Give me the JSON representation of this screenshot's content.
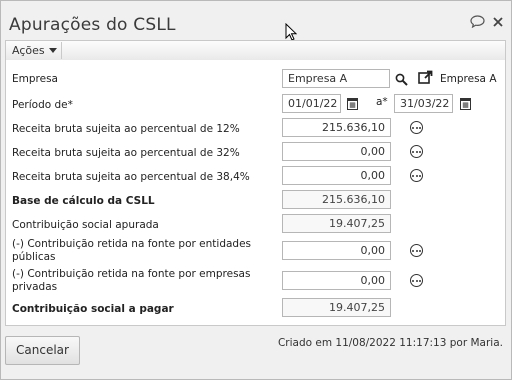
{
  "dialog": {
    "title": "Apurações do CSLL",
    "toolbar": {
      "actions_label": "Ações"
    }
  },
  "form": {
    "empresa": {
      "label": "Empresa",
      "value": "Empresa A",
      "linked_name": "Empresa A"
    },
    "periodo": {
      "label": "Período de*",
      "from": "01/01/22",
      "to_label": "a*",
      "to": "31/03/22"
    },
    "rows": [
      {
        "label": "Receita bruta sujeita ao percentual de 12%",
        "value": "215.636,10",
        "bold": false,
        "editable": true
      },
      {
        "label": "Receita bruta sujeita ao percentual de 32%",
        "value": "0,00",
        "bold": false,
        "editable": true
      },
      {
        "label": "Receita bruta sujeita ao percentual de 38,4%",
        "value": "0,00",
        "bold": false,
        "editable": true
      },
      {
        "label": "Base de cálculo da CSLL",
        "value": "215.636,10",
        "bold": true,
        "editable": false
      },
      {
        "label": "Contribuição social apurada",
        "value": "19.407,25",
        "bold": false,
        "editable": false
      },
      {
        "label": "(-) Contribuição retida na fonte por entidades públicas",
        "value": "0,00",
        "bold": false,
        "editable": true
      },
      {
        "label": "(-) Contribuição retida na fonte por empresas privadas",
        "value": "0,00",
        "bold": false,
        "editable": true
      },
      {
        "label": "Contribuição social a pagar",
        "value": "19.407,25",
        "bold": true,
        "editable": false
      }
    ]
  },
  "footer": {
    "cancel_label": "Cancelar",
    "created_note": "Criado em 11/08/2022 11:17:13 por Maria."
  },
  "icons": {
    "chat": "chat-bubble-icon",
    "close": "close-icon",
    "search": "search-icon",
    "open": "external-link-icon",
    "calendar": "calendar-icon",
    "more": "more-options-icon"
  }
}
